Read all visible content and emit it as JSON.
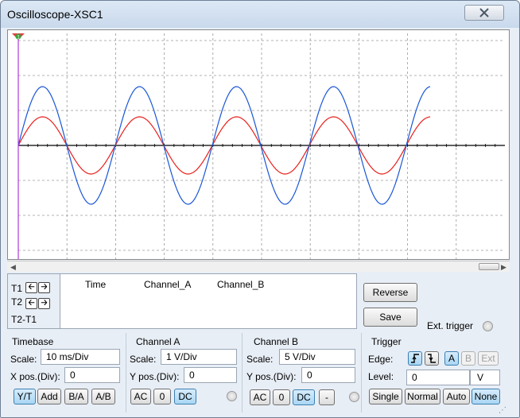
{
  "window": {
    "title": "Oscilloscope-XSC1",
    "close_icon": "close-icon"
  },
  "scope": {
    "background": "#ffffff",
    "grid_color": "#9a9a9a",
    "channel_a_color": "#e8201c",
    "channel_b_color": "#1a56d6",
    "cursor_color": "#b13ad9",
    "cursor_marker": "1"
  },
  "cursors": {
    "t1_label": "T1",
    "t2_label": "T2",
    "diff_label": "T2-T1",
    "columns": [
      "Time",
      "Channel_A",
      "Channel_B"
    ]
  },
  "actions": {
    "reverse_label": "Reverse",
    "save_label": "Save",
    "ext_trigger_label": "Ext. trigger"
  },
  "timebase": {
    "title": "Timebase",
    "scale_label": "Scale:",
    "scale_value": "10 ms/Div",
    "xpos_label": "X pos.(Div):",
    "xpos_value": "0",
    "modes": [
      "Y/T",
      "Add",
      "B/A",
      "A/B"
    ]
  },
  "channel_a": {
    "title": "Channel A",
    "scale_label": "Scale:",
    "scale_value": "1 V/Div",
    "ypos_label": "Y pos.(Div):",
    "ypos_value": "0",
    "coupling": [
      "AC",
      "0",
      "DC"
    ]
  },
  "channel_b": {
    "title": "Channel B",
    "scale_label": "Scale:",
    "scale_value": "5 V/Div",
    "ypos_label": "Y pos.(Div):",
    "ypos_value": "0",
    "coupling": [
      "AC",
      "0",
      "DC",
      "-"
    ]
  },
  "trigger": {
    "title": "Trigger",
    "edge_label": "Edge:",
    "sources": [
      "A",
      "B",
      "Ext"
    ],
    "level_label": "Level:",
    "level_value": "0",
    "level_unit": "V",
    "modes": [
      "Single",
      "Normal",
      "Auto",
      "None"
    ]
  }
}
